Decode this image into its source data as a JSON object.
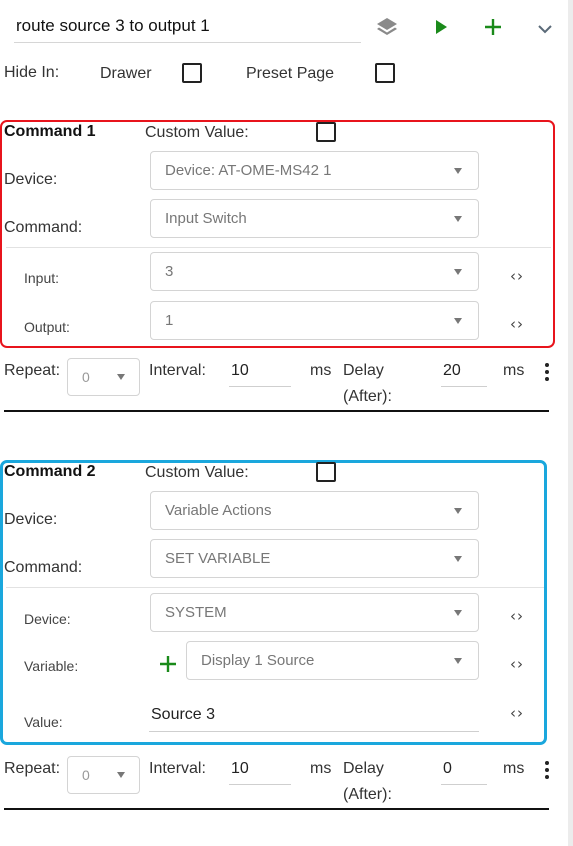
{
  "header": {
    "title_value": "route source 3 to output 1"
  },
  "hide_in": {
    "label": "Hide In:",
    "drawer_label": "Drawer",
    "preset_label": "Preset Page"
  },
  "commands": [
    {
      "title": "Command 1",
      "custom_value_label": "Custom Value:",
      "device_label": "Device:",
      "device_value": "Device: AT-OME-MS42 1",
      "command_label": "Command:",
      "command_value": "Input Switch",
      "params": [
        {
          "label": "Input:",
          "value": "3"
        },
        {
          "label": "Output:",
          "value": "1"
        }
      ],
      "repeat_label": "Repeat:",
      "repeat_value": "0",
      "interval_label": "Interval:",
      "interval_value": "10",
      "interval_unit": "ms",
      "delay_label_1": "Delay",
      "delay_label_2": "(After):",
      "delay_value": "20",
      "delay_unit": "ms",
      "accent_color": "#e8141c"
    },
    {
      "title": "Command 2",
      "custom_value_label": "Custom Value:",
      "device_label": "Device:",
      "device_value": "Variable Actions",
      "command_label": "Command:",
      "command_value": "SET VARIABLE",
      "params": [
        {
          "label": "Device:",
          "value": "SYSTEM"
        },
        {
          "label": "Variable:",
          "value": "Display 1 Source"
        },
        {
          "label": "Value:",
          "value": "Source 3"
        }
      ],
      "repeat_label": "Repeat:",
      "repeat_value": "0",
      "interval_label": "Interval:",
      "interval_value": "10",
      "interval_unit": "ms",
      "delay_label_1": "Delay",
      "delay_label_2": "(After):",
      "delay_value": "0",
      "delay_unit": "ms",
      "accent_color": "#1aa7dd"
    }
  ],
  "icons": {
    "layers": "layers-icon",
    "play": "play-icon",
    "add": "plus-icon",
    "expand": "chevron-down-icon",
    "code": "code-icon",
    "more": "more-vertical-icon"
  },
  "colors": {
    "green": "#1a8a1a",
    "gray_icon": "#8a8a8a"
  }
}
